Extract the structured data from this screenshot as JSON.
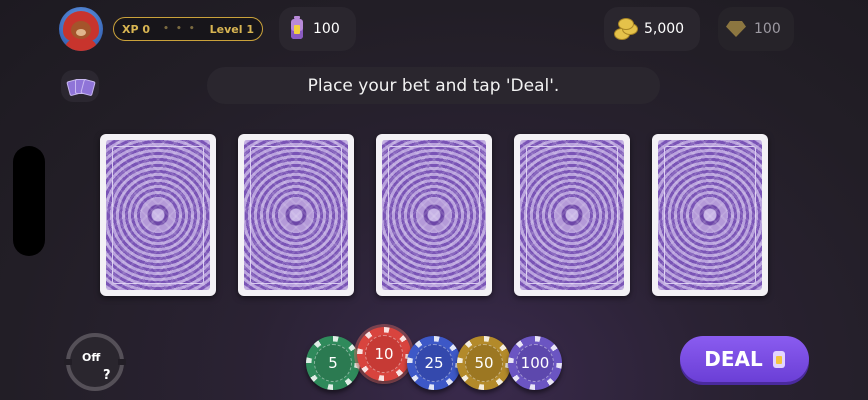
{
  "header": {
    "avatar_icon": "bear-avatar-icon",
    "xp_label": "XP 0",
    "level_label": "Level 1",
    "energy_value": "100",
    "gold_value": "5,000",
    "gems_value": "100"
  },
  "message": "Place your bet and tap 'Deal'.",
  "cards": [
    {
      "state": "face-down"
    },
    {
      "state": "face-down"
    },
    {
      "state": "face-down"
    },
    {
      "state": "face-down"
    },
    {
      "state": "face-down"
    }
  ],
  "autoplay": {
    "label": "Off",
    "help": "?"
  },
  "chips": [
    {
      "value": "5",
      "color": "#2f8a5b"
    },
    {
      "value": "10",
      "color": "#d8443e",
      "selected": true
    },
    {
      "value": "25",
      "color": "#3d58c7"
    },
    {
      "value": "50",
      "color": "#b38a2a"
    },
    {
      "value": "100",
      "color": "#6b55c2"
    }
  ],
  "deal_button": {
    "label": "DEAL"
  },
  "colors": {
    "accent": "#7a4fe6",
    "gold": "#caa23b"
  }
}
